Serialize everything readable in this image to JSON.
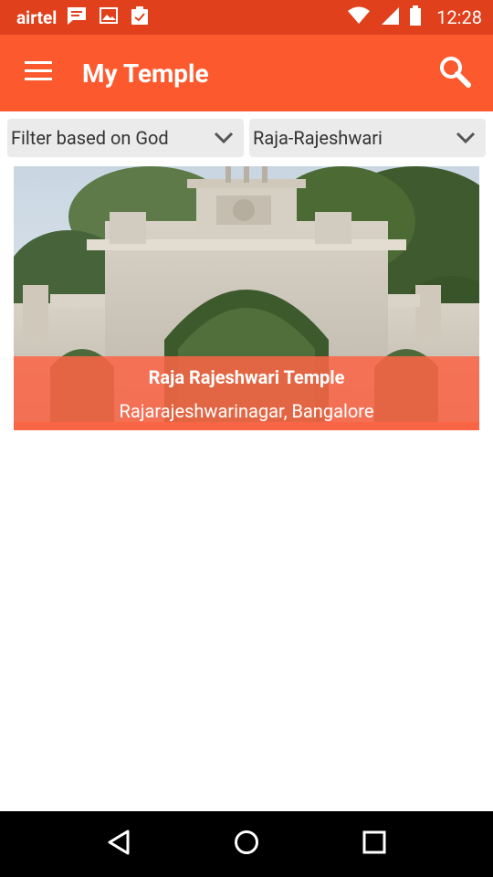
{
  "status_bar": {
    "carrier": "airtel",
    "time": "12:28",
    "icons": [
      "message-icon",
      "image-icon",
      "clipboard-check-icon",
      "wifi-icon",
      "signal-icon",
      "battery-icon"
    ]
  },
  "app_bar": {
    "title": "My Temple",
    "menu_icon": "hamburger-menu-icon",
    "search_icon": "search-icon"
  },
  "filters": {
    "god_filter": "Filter based on God",
    "selected_god": "Raja-Rajeshwari"
  },
  "temples": [
    {
      "name": "Raja Rajeshwari Temple",
      "location": "Rajarajeshwarinagar, Bangalore"
    }
  ],
  "nav_bar": {
    "icons": [
      "back-icon",
      "home-icon",
      "recents-icon"
    ]
  },
  "colors": {
    "status_bar": "#e0401c",
    "app_bar": "#fc5a2e",
    "card_overlay": "#fc6446"
  }
}
